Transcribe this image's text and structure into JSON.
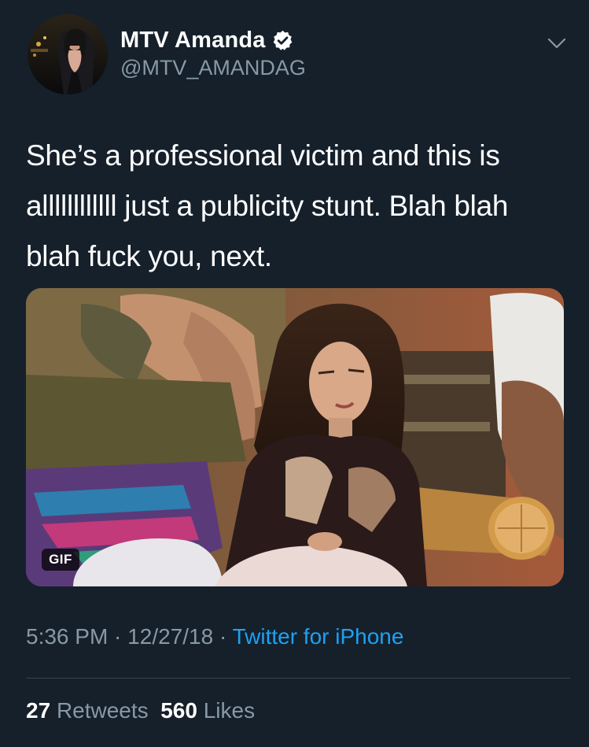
{
  "author": {
    "display_name": "MTV Amanda",
    "handle": "@MTV_AMANDAG",
    "verified": true,
    "verified_icon": "verified-badge-icon",
    "avatar_icon": "profile-photo"
  },
  "menu": {
    "icon": "chevron-down-icon"
  },
  "tweet": {
    "line1": "She’s a professional victim and this is",
    "line2": "allllllllllll just a publicity stunt. Blah blah",
    "line3": "blah fuck you, next."
  },
  "media": {
    "type": "gif",
    "badge_label": "GIF"
  },
  "meta": {
    "time": "5:36 PM",
    "separator1": " · ",
    "date": "12/27/18",
    "separator2": " · ",
    "source": "Twitter for iPhone"
  },
  "stats": {
    "retweets_count": "27",
    "retweets_label": "Retweets",
    "likes_count": "560",
    "likes_label": "Likes"
  },
  "colors": {
    "background": "#15202b",
    "text_primary": "#ffffff",
    "text_secondary": "#8899a6",
    "link": "#1da1f2",
    "divider": "#38444d"
  }
}
